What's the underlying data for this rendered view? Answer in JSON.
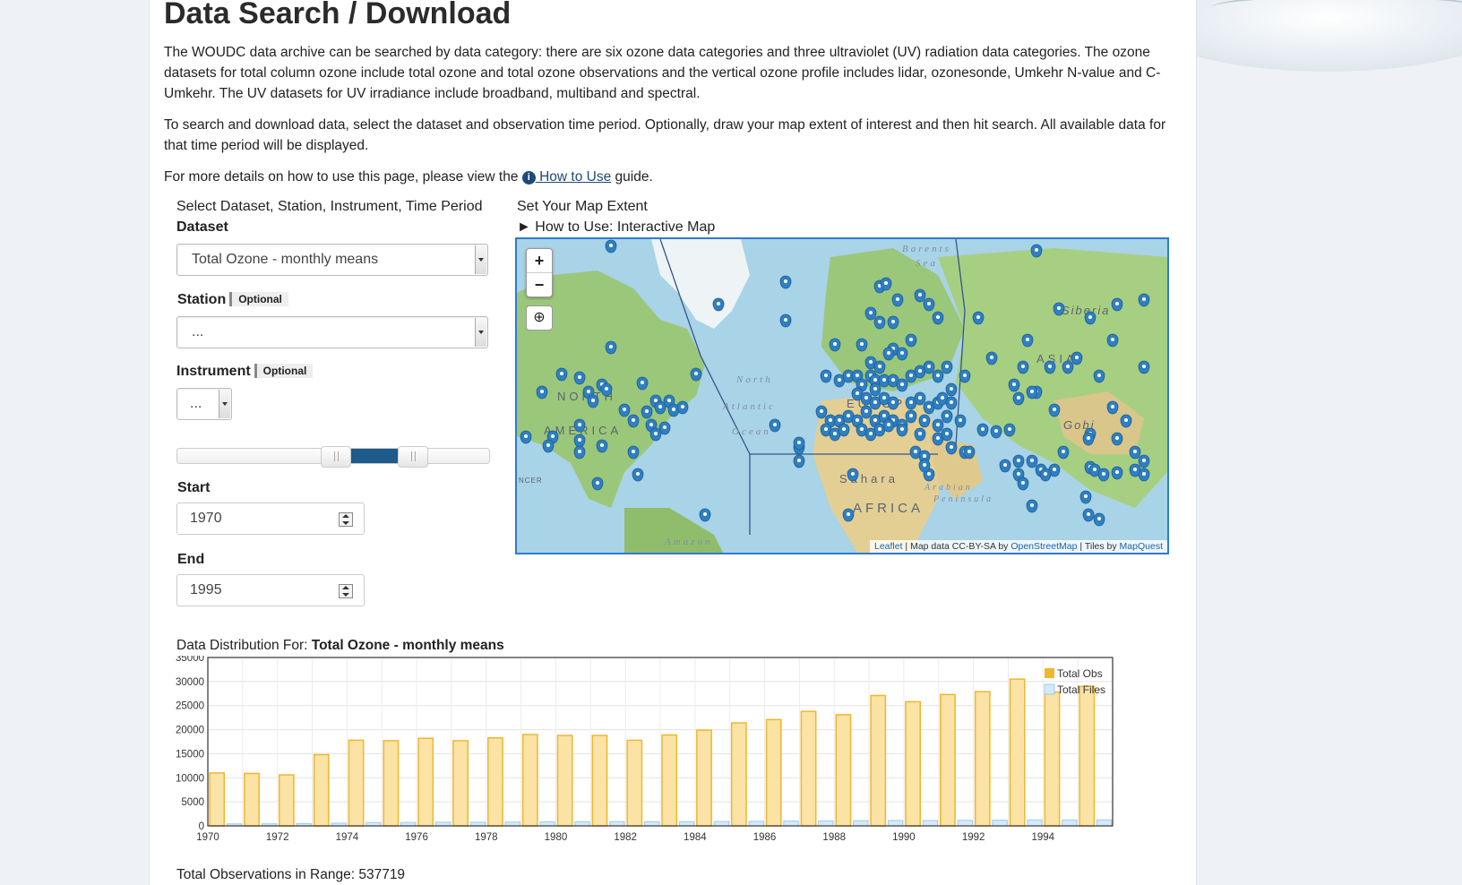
{
  "page": {
    "title": "Data Search / Download",
    "intro": "The WOUDC data archive can be searched by data category: there are six ozone data categories and three ultraviolet (UV) radiation data categories. The ozone datasets for total column ozone include total ozone and total ozone observations and the vertical ozone profile includes lidar, ozonesonde, Umkehr N-value and C-Umkehr. The UV datasets for UV irradiance include broadband, multiband and spectral.",
    "instructions": "To search and download data, select the dataset and observation time period. Optionally, draw your map extent of interest and then hit search. All available data for that time period will be displayed.",
    "details_prefix": "For more details on how to use this page, please view the",
    "details_link": " How to Use",
    "details_suffix": " guide.",
    "info_icon": "i"
  },
  "form": {
    "heading": "Select Dataset, Station, Instrument, Time Period",
    "dataset_label": "Dataset",
    "dataset_value": "Total Ozone - monthly means",
    "station_label": "Station",
    "station_optional": "Optional",
    "station_value": "...",
    "instrument_label": "Instrument",
    "instrument_optional": "Optional",
    "instrument_value": "...",
    "start_label": "Start",
    "start_value": "1970",
    "end_label": "End",
    "end_value": "1995"
  },
  "map": {
    "heading": "Set Your Map Extent",
    "howto": "► How to Use: Interactive Map",
    "zoom_in": "+",
    "zoom_out": "−",
    "globe_icon": "globe-icon",
    "attribution_leaflet": "Leaflet",
    "attribution_mid": " | Map data CC-BY-SA by ",
    "attribution_osm": "OpenStreetMap",
    "attribution_tiles": " | Tiles by ",
    "attribution_mapquest": "MapQuest",
    "labels": {
      "barents": "Barents",
      "sea": "Sea",
      "siberia": "Siberia",
      "asia": "ASIA",
      "north": "NORTH",
      "america": "AMERICA",
      "europe": "EUROPE",
      "north_atl": "North",
      "atlantic": "Atlantic",
      "ocean": "Ocean",
      "sahara": "Sahara",
      "arabian": "Arabian",
      "peninsula": "Peninsula",
      "africa": "AFRICA",
      "gobi": "Gobi",
      "amazon": "Amazon",
      "ncer": "NCER"
    },
    "colors": {
      "water": "#a9d3e6",
      "land": "#9bc77a",
      "ice": "#eef3f6",
      "desert": "#e3cf94",
      "marker": "#2f7fc1"
    }
  },
  "distribution": {
    "label": "Data Distribution For: ",
    "dataset": "Total Ozone - monthly means",
    "total_obs_text": "Total Observations in Range: 537719"
  },
  "chart_data": {
    "type": "bar",
    "categories": [
      "1970",
      "1971",
      "1972",
      "1973",
      "1974",
      "1975",
      "1976",
      "1977",
      "1978",
      "1979",
      "1980",
      "1981",
      "1982",
      "1983",
      "1984",
      "1985",
      "1986",
      "1987",
      "1988",
      "1989",
      "1990",
      "1991",
      "1992",
      "1993",
      "1994",
      "1995"
    ],
    "x_tick_labels": [
      "1970",
      "1972",
      "1974",
      "1976",
      "1978",
      "1980",
      "1982",
      "1984",
      "1986",
      "1988",
      "1990",
      "1992",
      "1994"
    ],
    "y_ticks": [
      "0",
      "5000",
      "10000",
      "15000",
      "20000",
      "25000",
      "30000",
      "35000"
    ],
    "ylim": [
      0,
      35000
    ],
    "series": [
      {
        "name": "Total Obs",
        "color": "#f0b631",
        "fill": "#fae3a4",
        "values": [
          11000,
          10900,
          10600,
          14800,
          17800,
          17700,
          18200,
          17700,
          18300,
          19000,
          18800,
          18800,
          17800,
          18900,
          19900,
          21400,
          22100,
          23800,
          23100,
          27100,
          25800,
          27300,
          27900,
          30500,
          27800,
          29000
        ]
      },
      {
        "name": "Total Files",
        "color": "#9ccbee",
        "fill": "#d4eafb",
        "values": [
          420,
          430,
          460,
          560,
          700,
          720,
          760,
          750,
          800,
          830,
          840,
          850,
          860,
          880,
          920,
          960,
          1000,
          1040,
          1070,
          1120,
          1120,
          1160,
          1190,
          1230,
          1220,
          1250
        ]
      }
    ],
    "legend_position": "top-right",
    "grid": true
  }
}
